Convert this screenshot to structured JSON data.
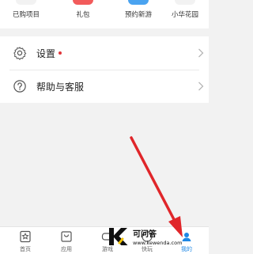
{
  "quick_links": [
    {
      "label": "已购项目",
      "accent": "#f2f2f2"
    },
    {
      "label": "礼包",
      "accent": "#f25b5b"
    },
    {
      "label": "预约新游",
      "accent": "#4aa3f0"
    },
    {
      "label": "小华花园",
      "accent": "#f2f2f2"
    }
  ],
  "settings_list": [
    {
      "label": "设置",
      "icon": "gear-icon",
      "has_badge": true
    },
    {
      "label": "帮助与客服",
      "icon": "help-icon",
      "has_badge": false
    }
  ],
  "tabbar": {
    "tabs": [
      {
        "label": "首页",
        "icon": "home-star-icon",
        "active": false
      },
      {
        "label": "应用",
        "icon": "app-bag-icon",
        "active": false
      },
      {
        "label": "游戏",
        "icon": "game-icon",
        "active": false
      },
      {
        "label": "快玩",
        "icon": "quick-play-icon",
        "active": false
      },
      {
        "label": "我的",
        "icon": "profile-icon",
        "active": true
      }
    ]
  },
  "watermark": {
    "title": "可问答",
    "url": "www.kewenda.com"
  },
  "colors": {
    "accent": "#1e88e5",
    "badge": "#e0363a",
    "arrow": "#e0262a"
  }
}
